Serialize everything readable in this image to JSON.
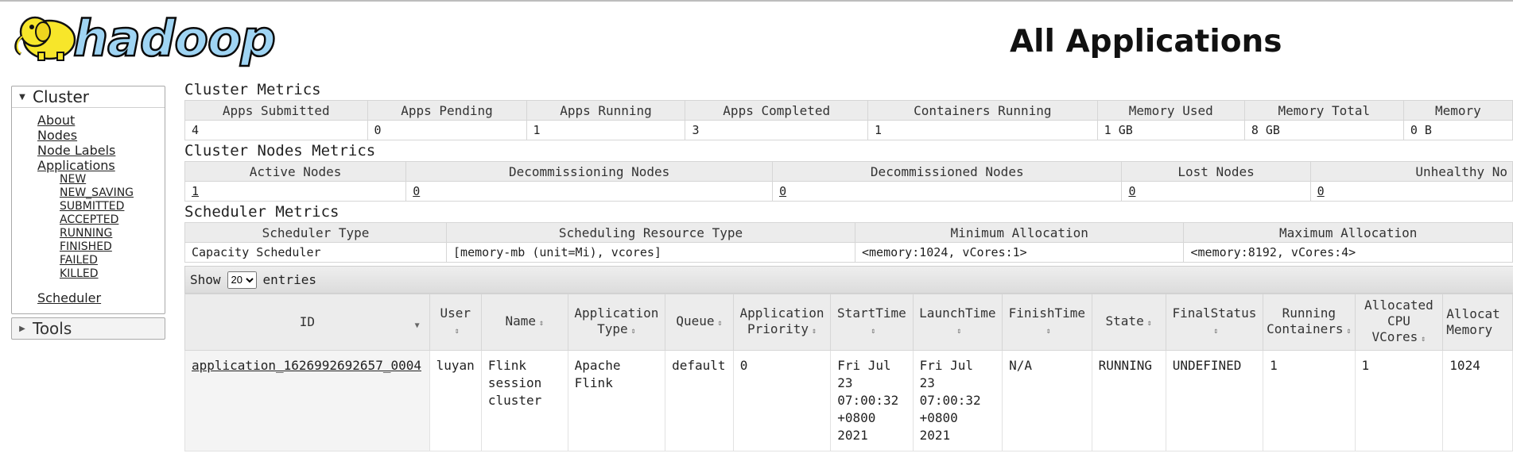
{
  "header": {
    "logo_text": "hadoop",
    "page_title": "All Applications"
  },
  "sidebar": {
    "cluster_label": "Cluster",
    "links": [
      "About",
      "Nodes",
      "Node Labels",
      "Applications"
    ],
    "app_states": [
      "NEW",
      "NEW_SAVING",
      "SUBMITTED",
      "ACCEPTED",
      "RUNNING",
      "FINISHED",
      "FAILED",
      "KILLED"
    ],
    "scheduler": "Scheduler",
    "tools_label": "Tools"
  },
  "cluster_metrics": {
    "title": "Cluster Metrics",
    "headers": [
      "Apps Submitted",
      "Apps Pending",
      "Apps Running",
      "Apps Completed",
      "Containers Running",
      "Memory Used",
      "Memory Total",
      "Memory"
    ],
    "values": [
      "4",
      "0",
      "1",
      "3",
      "1",
      "1 GB",
      "8 GB",
      "0 B"
    ]
  },
  "nodes_metrics": {
    "title": "Cluster Nodes Metrics",
    "headers": [
      "Active Nodes",
      "Decommissioning Nodes",
      "Decommissioned Nodes",
      "Lost Nodes",
      "Unhealthy No"
    ],
    "values": [
      "1",
      "0",
      "0",
      "0",
      "0"
    ]
  },
  "scheduler_metrics": {
    "title": "Scheduler Metrics",
    "headers": [
      "Scheduler Type",
      "Scheduling Resource Type",
      "Minimum Allocation",
      "Maximum Allocation"
    ],
    "values": [
      "Capacity Scheduler",
      "[memory-mb (unit=Mi), vcores]",
      "<memory:1024, vCores:1>",
      "<memory:8192, vCores:4>"
    ]
  },
  "entries": {
    "show": "Show",
    "selected": "20",
    "suffix": "entries"
  },
  "apps_table": {
    "headers": [
      "ID",
      "User",
      "Name",
      "Application Type",
      "Queue",
      "Application Priority",
      "StartTime",
      "LaunchTime",
      "FinishTime",
      "State",
      "FinalStatus",
      "Running Containers",
      "Allocated CPU VCores",
      "Allocat Memory"
    ],
    "row": {
      "id": "application_1626992692657_0004",
      "user": "luyan",
      "name": "Flink session cluster",
      "type": "Apache Flink",
      "queue": "default",
      "priority": "0",
      "start": "Fri Jul 23 07:00:32 +0800 2021",
      "launch": "Fri Jul 23 07:00:32 +0800 2021",
      "finish": "N/A",
      "state": "RUNNING",
      "final_status": "UNDEFINED",
      "running_containers": "1",
      "vcores": "1",
      "memory": "1024"
    }
  }
}
